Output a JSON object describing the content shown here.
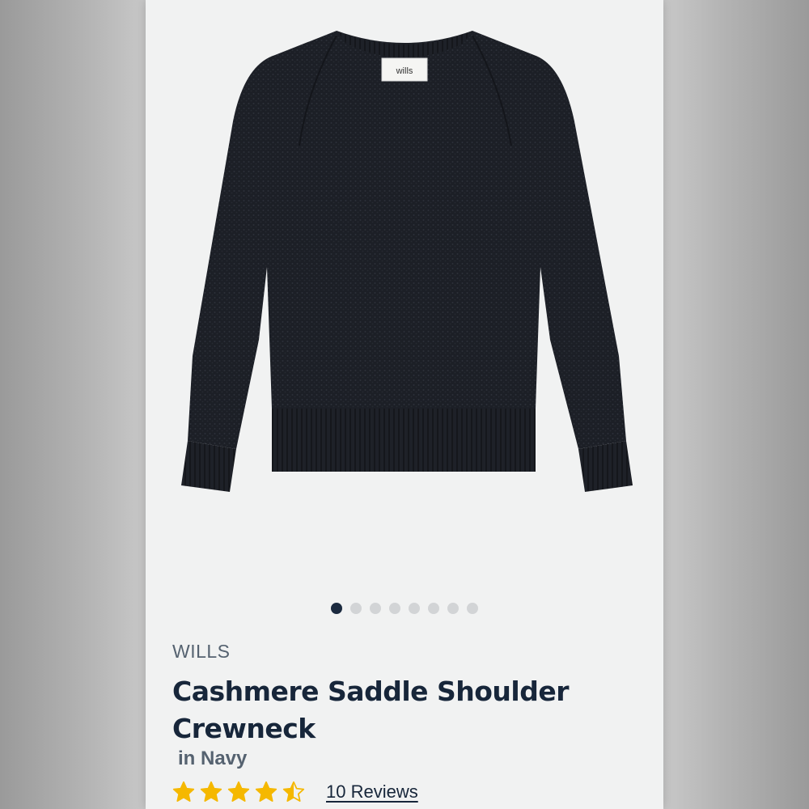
{
  "product": {
    "brand": "WILLS",
    "title": "Cashmere Saddle Shoulder Crewneck",
    "color_line": "in Navy",
    "label_text": "wills",
    "rating": 4.5,
    "rating_max": 5,
    "reviews_label": "10 Reviews"
  },
  "carousel": {
    "total": 8,
    "active_index": 0
  },
  "colors": {
    "star": "#f5b800",
    "text_dark": "#17263a",
    "text_muted": "#556270",
    "dot_active": "#1b2a3f",
    "dot_inactive": "#d2d4d6"
  },
  "icons": {
    "star_full": "star-icon",
    "star_half": "half-star-icon"
  }
}
